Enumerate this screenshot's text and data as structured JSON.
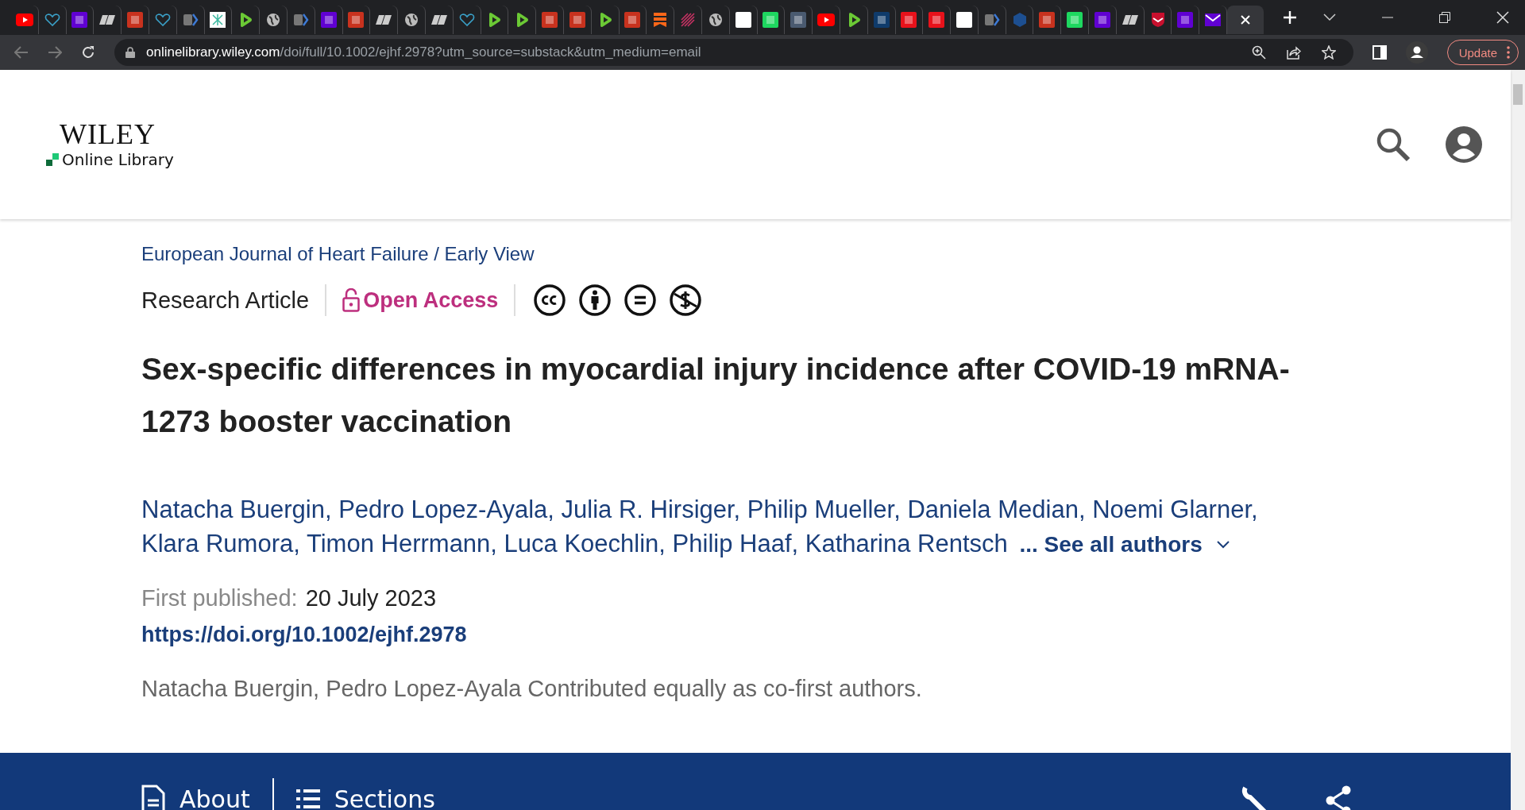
{
  "browser": {
    "tabs": [
      {
        "kind": "youtube",
        "selected": false
      },
      {
        "kind": "heart",
        "selected": false
      },
      {
        "kind": "yahoo",
        "selected": false
      },
      {
        "kind": "dr",
        "selected": false
      },
      {
        "kind": "bi",
        "selected": false
      },
      {
        "kind": "heart",
        "selected": false
      },
      {
        "kind": "arrow",
        "selected": false
      },
      {
        "kind": "grid",
        "selected": false
      },
      {
        "kind": "play",
        "selected": false
      },
      {
        "kind": "globe",
        "selected": false
      },
      {
        "kind": "arrow",
        "selected": false
      },
      {
        "kind": "yahoo",
        "selected": false
      },
      {
        "kind": "bi",
        "selected": false
      },
      {
        "kind": "dr",
        "selected": false
      },
      {
        "kind": "globe",
        "selected": false
      },
      {
        "kind": "dr",
        "selected": false
      },
      {
        "kind": "heart",
        "selected": false
      },
      {
        "kind": "play",
        "selected": false
      },
      {
        "kind": "play",
        "selected": false
      },
      {
        "kind": "bi",
        "selected": false
      },
      {
        "kind": "bi",
        "selected": false
      },
      {
        "kind": "play",
        "selected": false
      },
      {
        "kind": "bi",
        "selected": false
      },
      {
        "kind": "bookmark",
        "selected": false
      },
      {
        "kind": "radial",
        "selected": false
      },
      {
        "kind": "globe",
        "selected": false
      },
      {
        "kind": "hw",
        "selected": false
      },
      {
        "kind": "g",
        "selected": false
      },
      {
        "kind": "person",
        "selected": false
      },
      {
        "kind": "youtube",
        "selected": false
      },
      {
        "kind": "play",
        "selected": false
      },
      {
        "kind": "darkblue",
        "selected": false
      },
      {
        "kind": "redbox",
        "selected": false
      },
      {
        "kind": "redbox",
        "selected": false
      },
      {
        "kind": "whitebox",
        "selected": false
      },
      {
        "kind": "arrow",
        "selected": false
      },
      {
        "kind": "cube",
        "selected": false
      },
      {
        "kind": "bi",
        "selected": false
      },
      {
        "kind": "g",
        "selected": false
      },
      {
        "kind": "yahoo",
        "selected": false
      },
      {
        "kind": "dr",
        "selected": false
      },
      {
        "kind": "shield",
        "selected": false
      },
      {
        "kind": "yahoo",
        "selected": false
      },
      {
        "kind": "mail",
        "selected": false
      },
      {
        "kind": "blank",
        "selected": true
      }
    ],
    "address": {
      "host": "onlinelibrary.wiley.com",
      "path": "/doi/full/10.1002/ejhf.2978?utm_source=substack&utm_medium=email"
    },
    "update_button": "Update"
  },
  "site": {
    "logo_top": "WILEY",
    "logo_bottom": "Online Library"
  },
  "article": {
    "breadcrumb": "European Journal of Heart Failure / Early View",
    "type": "Research Article",
    "access": "Open Access",
    "title": "Sex-specific differences in myocardial injury incidence after COVID-19 mRNA-1273 booster vaccination",
    "authors": [
      "Natacha Buergin",
      "Pedro Lopez-Ayala",
      "Julia R. Hirsiger",
      "Philip Mueller",
      "Daniela Median",
      "Noemi Glarner",
      "Klara Rumora",
      "Timon Herrmann",
      "Luca Koechlin",
      "Philip Haaf",
      "Katharina Rentsch"
    ],
    "author_separator": ",",
    "see_all": "... See all authors",
    "published_label": "First published:",
    "published_date": "20 July 2023",
    "doi": "https://doi.org/10.1002/ejhf.2978",
    "note": "Natacha Buergin, Pedro Lopez-Ayala Contributed equally as co-first authors."
  },
  "toolbar": {
    "about": "About",
    "sections": "Sections"
  }
}
